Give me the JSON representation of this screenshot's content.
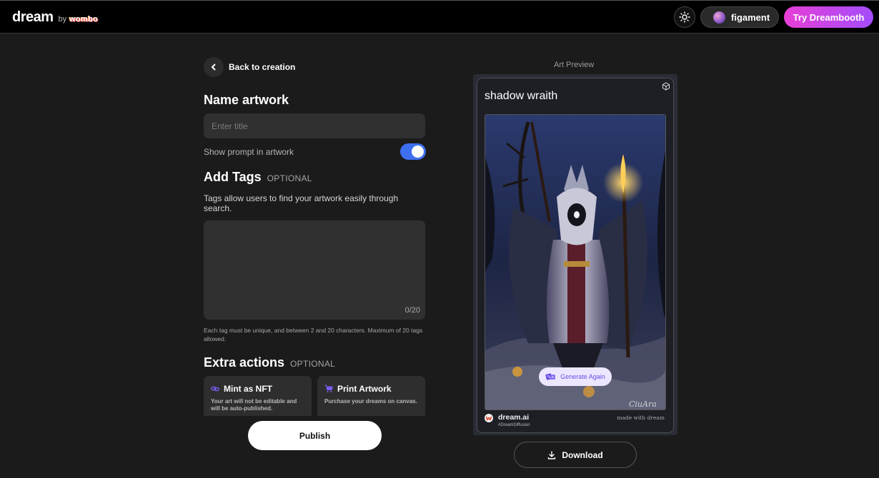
{
  "header": {
    "logo_word": "dream",
    "logo_by": "by",
    "logo_brand": "wombo",
    "user_name": "figament",
    "dreambooth_label": "Try Dreambooth"
  },
  "editor": {
    "back_label": "Back to creation",
    "name_heading": "Name artwork",
    "title_placeholder": "Enter title",
    "title_value": "",
    "show_prompt_label": "Show prompt in artwork",
    "show_prompt_enabled": true,
    "tags_heading": "Add Tags",
    "tags_optional": "OPTIONAL",
    "tags_description": "Tags allow users to find your artwork easily through search.",
    "tag_count": "0/20",
    "tags_note": "Each tag must be unique, and between 2 and 20 characters. Maximum of 20 tags allowed.",
    "extra_heading": "Extra actions",
    "extra_optional": "OPTIONAL",
    "actions": [
      {
        "title": "Mint as NFT",
        "description": "Your art will not be editable and will be auto-published.",
        "icon": "link-icon"
      },
      {
        "title": "Print Artwork",
        "description": "Purchase your dreams on canvas.",
        "icon": "cart-icon"
      }
    ],
    "publish_label": "Publish"
  },
  "preview": {
    "label": "Art Preview",
    "art_title": "shadow wraith",
    "generate_again_label": "Generate Again",
    "signature": "CiuAra",
    "brand_name": "dream.ai",
    "brand_hashtag": "#DreamDiffusion",
    "made_with": "made with dream",
    "download_label": "Download"
  },
  "colors": {
    "accent_blue": "#3e6ff0",
    "dreambooth_gradient_start": "#e83fd6",
    "dreambooth_gradient_end": "#a34dfb",
    "icon_purple": "#7b5cf0"
  }
}
